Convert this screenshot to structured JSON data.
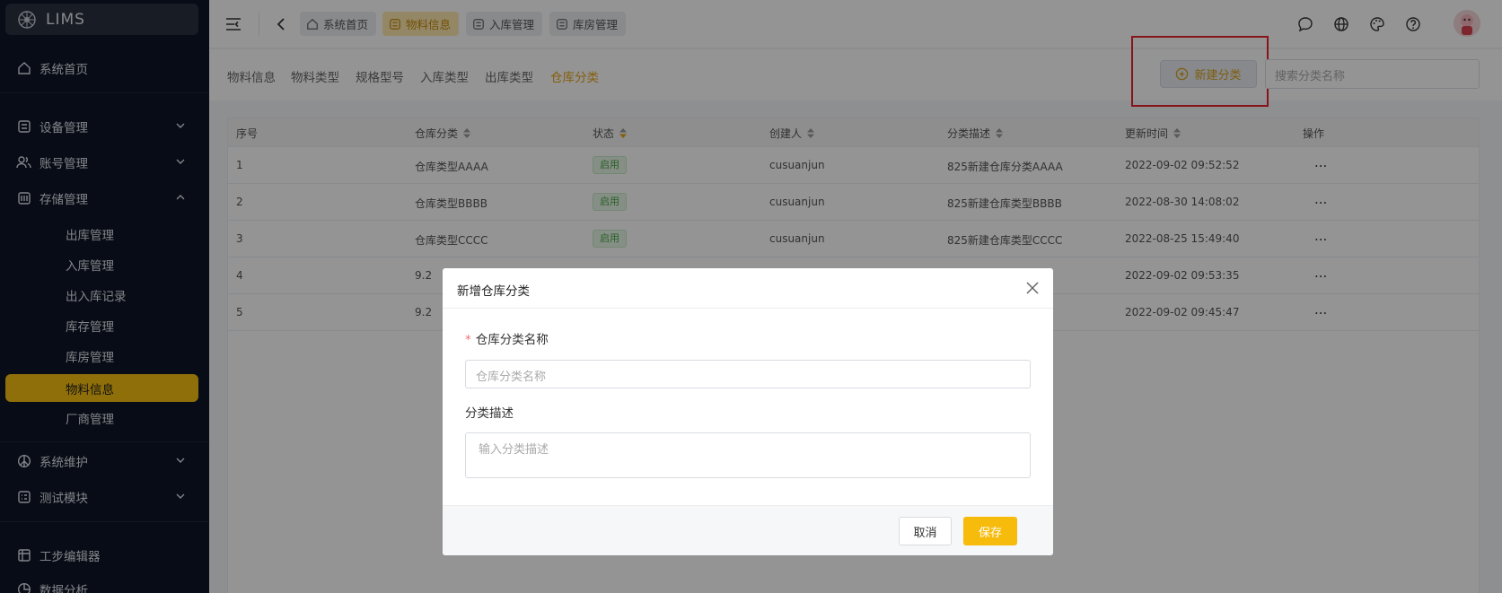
{
  "app": {
    "name": "LIMS"
  },
  "sidebar": {
    "items": [
      {
        "label": "系统首页",
        "icon": "home-icon"
      },
      {
        "label": "设备管理",
        "icon": "device-icon"
      },
      {
        "label": "账号管理",
        "icon": "users-icon"
      },
      {
        "label": "存储管理",
        "icon": "storage-icon"
      },
      {
        "label": "系统维护",
        "icon": "peace-icon"
      },
      {
        "label": "测试模块",
        "icon": "grid-icon"
      },
      {
        "label": "工步编辑器",
        "icon": "table-icon"
      },
      {
        "label": "数据分析",
        "icon": "pie-icon"
      }
    ],
    "sub_items": [
      "出库管理",
      "入库管理",
      "出入库记录",
      "库存管理",
      "库房管理",
      "物料信息",
      "厂商管理"
    ],
    "active_sub": "物料信息"
  },
  "topbar": {
    "tags": [
      {
        "label": "系统首页",
        "icon": "home-icon"
      },
      {
        "label": "物料信息",
        "icon": "box-icon"
      },
      {
        "label": "入库管理",
        "icon": "box-icon"
      },
      {
        "label": "库房管理",
        "icon": "box-icon"
      }
    ],
    "active_tag": "物料信息"
  },
  "subnav": {
    "tabs": [
      "物料信息",
      "物料类型",
      "规格型号",
      "入库类型",
      "出库类型",
      "仓库分类"
    ],
    "active_tab": "仓库分类"
  },
  "toolbar": {
    "new_label": "新建分类",
    "search_placeholder": "搜索分类名称"
  },
  "table": {
    "columns": [
      "序号",
      "仓库分类",
      "状态",
      "创建人",
      "分类描述",
      "更新时间",
      "操作"
    ],
    "rows": [
      {
        "no": "1",
        "category": "仓库类型AAAA",
        "status": "启用",
        "creator": "cusuanjun",
        "desc": "825新建仓库分类AAAA",
        "updated": "2022-09-02 09:52:52",
        "action": "..."
      },
      {
        "no": "2",
        "category": "仓库类型BBBB",
        "status": "启用",
        "creator": "cusuanjun",
        "desc": "825新建仓库类型BBBB",
        "updated": "2022-08-30 14:08:02",
        "action": "..."
      },
      {
        "no": "3",
        "category": "仓库类型CCCC",
        "status": "启用",
        "creator": "cusuanjun",
        "desc": "825新建仓库类型CCCC",
        "updated": "2022-08-25 15:49:40",
        "action": "..."
      },
      {
        "no": "4",
        "category": "9.2",
        "status": "",
        "creator": "",
        "desc": "",
        "updated": "2022-09-02 09:53:35",
        "action": "..."
      },
      {
        "no": "5",
        "category": "9.2",
        "status": "",
        "creator": "",
        "desc": "",
        "updated": "2022-09-02 09:45:47",
        "action": "..."
      }
    ]
  },
  "modal": {
    "title": "新增仓库分类",
    "name_label": "仓库分类名称",
    "name_placeholder": "仓库分类名称",
    "desc_label": "分类描述",
    "desc_placeholder": "输入分类描述",
    "cancel_label": "取消",
    "save_label": "保存",
    "required_mark": "*"
  },
  "colors": {
    "accent": "#f7bb0c",
    "sidebar_bg": "#0e1526",
    "highlight": "#e8232b"
  }
}
